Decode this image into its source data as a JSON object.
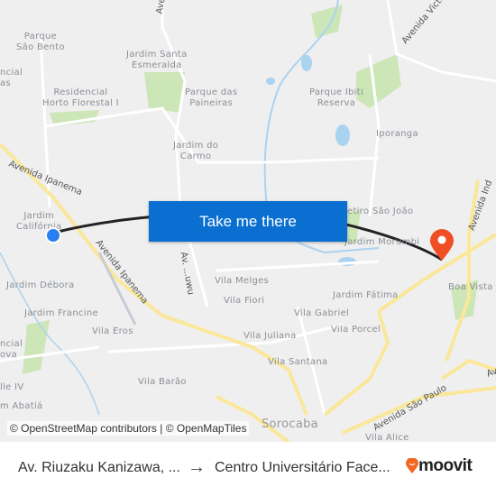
{
  "map": {
    "action_button": "Take me there",
    "attribution": "© OpenStreetMap contributors | © OpenMapTiles",
    "labels": {
      "parque_sao_bento": "Parque\nSão Bento",
      "jardim_santa_esmeralda": "Jardim Santa\nEsmeralda",
      "residencial_left": "ncial\nas",
      "residencial_horto": "Residencial\nHorto Florestal I",
      "parque_paineiras": "Parque das\nPaineiras",
      "jardim_carmo": "Jardim do\nCarmo",
      "parque_ibiti": "Parque Ibiti\nReserva",
      "iporanga": "Iporanga",
      "jardim_california": "Jardim\nCalifórnia",
      "retiro_sao_joao": "etiro São João",
      "jardim_morumbi": "Jardim Morumbi",
      "jardim_debora": "Jardim Débora",
      "vila_melges": "Vila Melges",
      "vila_fiori": "Vila Fiori",
      "jardim_fatima": "Jardim Fátima",
      "boa_vista": "Boa Vista",
      "jardim_francine": "Jardim Francine",
      "vila_gabriel": "Vila Gabriel",
      "vila_eros": "Vila Eros",
      "vila_porcel": "Vila Porcel",
      "vila_juliana": "Vila Juliana",
      "residencial_nova": "ncial\nova",
      "vila_santana": "Vila Santana",
      "ville_iv": "lle IV",
      "vila_barao": "Vila Barão",
      "jardim_abatia": "m Abatiá",
      "sorocaba": "Sorocaba",
      "vila_alice": "Vila Alice"
    },
    "roads": {
      "avenida_ipanema_1": "Avenida Ipanema",
      "avenida_ipanema_2": "Avenida Ipanema",
      "avenida_victor_andrew": "Avenida Victor Andrew",
      "avenida_sao_paulo": "Avenida São Paulo",
      "av_top": "Ave",
      "av_mid": "Av. ...uwu",
      "av_ind": "Avenida Ind",
      "av_right": "Av"
    },
    "colors": {
      "route": "#222222",
      "origin": "#2a7ff0",
      "destination": "#f04e23",
      "button": "#0a6fd1",
      "park": "#cde6b8",
      "water": "#aad3f0",
      "major_road": "#fbe79a"
    }
  },
  "footer": {
    "from": "Av. Riuzaku Kanizawa, ...",
    "arrow": "→",
    "to": "Centro Universitário Face...",
    "brand": "moovit"
  }
}
